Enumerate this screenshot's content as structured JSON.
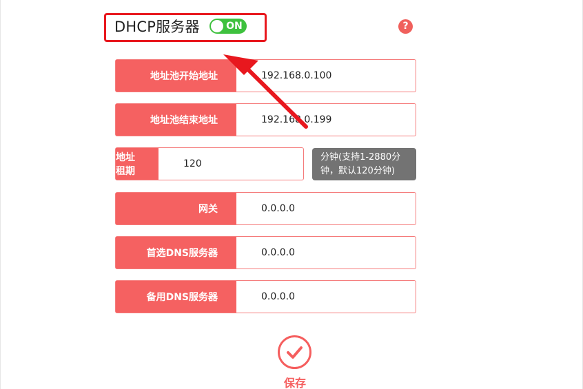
{
  "header": {
    "title": "DHCP服务器",
    "toggle_state": "ON",
    "help_icon": "question-circle-icon",
    "help_glyph": "?"
  },
  "form": {
    "pool_start": {
      "label": "地址池开始地址",
      "value": "192.168.0.100"
    },
    "pool_end": {
      "label": "地址池结束地址",
      "value": "192.168.0.199"
    },
    "lease": {
      "label": "地址租期",
      "value": "120",
      "hint_line1": "分钟(支持1-2880分",
      "hint_line2": "钟，默认120分钟)"
    },
    "gateway": {
      "label": "网关",
      "value": "0.0.0.0"
    },
    "dns_primary": {
      "label": "首选DNS服务器",
      "value": "0.0.0.0"
    },
    "dns_secondary": {
      "label": "备用DNS服务器",
      "value": "0.0.0.0"
    }
  },
  "save": {
    "label": "保存",
    "icon": "checkmark-circle-icon"
  },
  "colors": {
    "label_bg": "#f56161",
    "toggle_on": "#3ec13e",
    "annotation_red": "#e8181e",
    "hint_bg": "#737373"
  }
}
